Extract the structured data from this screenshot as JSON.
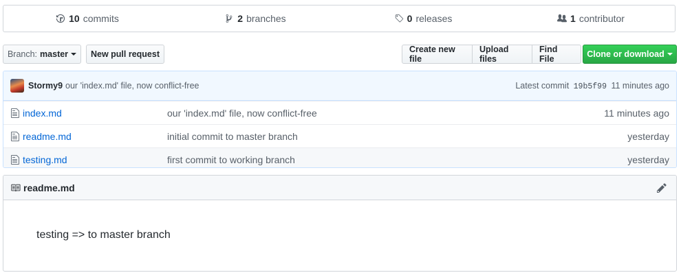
{
  "summary": {
    "commits": {
      "count": "10",
      "label": "commits",
      "icon": "history-icon"
    },
    "branches": {
      "count": "2",
      "label": "branches",
      "icon": "git-branch-icon"
    },
    "releases": {
      "count": "0",
      "label": "releases",
      "icon": "tag-icon"
    },
    "contributors": {
      "count": "1",
      "label": "contributor",
      "icon": "people-icon"
    }
  },
  "toolbar": {
    "branch_prefix": "Branch:",
    "branch_name": "master",
    "new_pull_request": "New pull request",
    "create_new_file": "Create new file",
    "upload_files": "Upload files",
    "find_file": "Find File",
    "clone_or_download": "Clone or download"
  },
  "latest_commit": {
    "author": "Stormy9",
    "message": "our 'index.md' file, now conflict-free",
    "prefix": "Latest commit",
    "sha": "19b5f99",
    "age": "11 minutes ago"
  },
  "files": [
    {
      "name": "index.md",
      "message": "our 'index.md' file, now conflict-free",
      "age": "11 minutes ago"
    },
    {
      "name": "readme.md",
      "message": "initial commit to master branch",
      "age": "yesterday"
    },
    {
      "name": "testing.md",
      "message": "first commit to working branch",
      "age": "yesterday"
    }
  ],
  "readme": {
    "filename": "readme.md",
    "content": "testing => to master branch"
  },
  "colors": {
    "link": "#0366d6",
    "green_button": "#28a745",
    "commit_bar": "#f1f8ff"
  }
}
